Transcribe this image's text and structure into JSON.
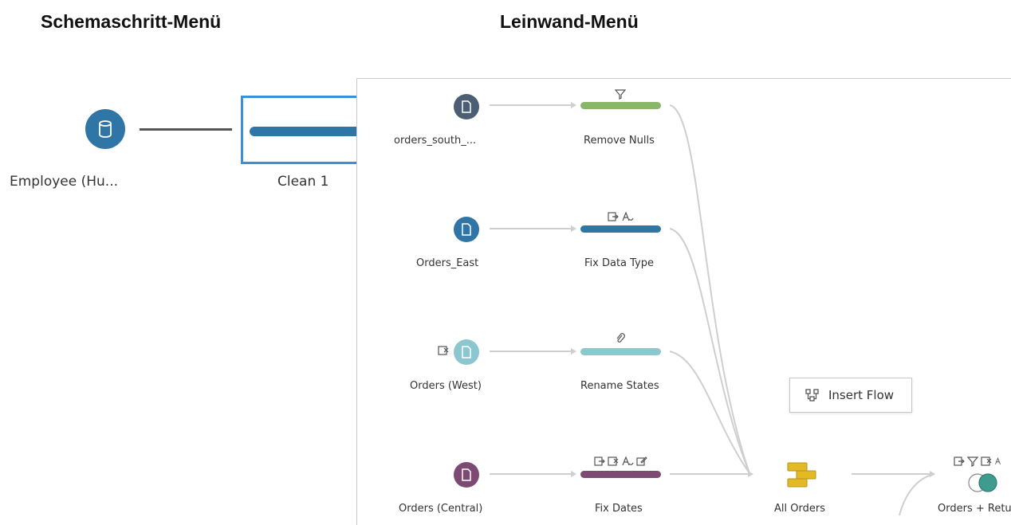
{
  "headings": {
    "step_menu": "Schemaschritt-Menü",
    "canvas_menu": "Leinwand-Menü"
  },
  "left_flow": {
    "input_node": {
      "label": "Employee (Hu...",
      "icon": "database-icon",
      "color": "#2f76a6"
    },
    "clean_step": {
      "label": "Clean 1",
      "bar_color": "#2f76a6",
      "selected_border": "#3d8fd6"
    }
  },
  "canvas": {
    "inputs": [
      {
        "label": "orders_south_...",
        "icon": "file-icon",
        "color": "#4b5e74"
      },
      {
        "label": "Orders_East",
        "icon": "file-icon",
        "color": "#2f76a6"
      },
      {
        "label": "Orders (West)",
        "icon": "file-icon",
        "color": "#8cc7cf",
        "change_icon": "removed-field-icon"
      },
      {
        "label": "Orders (Central)",
        "icon": "file-icon",
        "color": "#7d4a73"
      }
    ],
    "clean_steps": [
      {
        "label": "Remove Nulls",
        "color": "#8ab66a",
        "annotations": [
          "filter-icon"
        ]
      },
      {
        "label": "Fix Data Type",
        "color": "#2f76a6",
        "annotations": [
          "rename-field-icon",
          "change-type-icon"
        ]
      },
      {
        "label": "Rename States",
        "color": "#8cc7cf",
        "annotations": [
          "paperclip-icon"
        ]
      },
      {
        "label": "Fix Dates",
        "color": "#7d4a73",
        "annotations": [
          "rename-field-icon",
          "removed-field-icon",
          "change-type-icon",
          "edit-value-icon"
        ]
      }
    ],
    "union": {
      "label": "All Orders",
      "icon": "union-icon",
      "color": "#e3b926"
    },
    "join": {
      "label": "Orders + Retur",
      "icon": "join-icon",
      "colors": [
        "#ffffff",
        "#3f9b8e"
      ],
      "annotations": [
        "rename-field-icon",
        "filter-icon",
        "removed-field-icon",
        "change-type-icon"
      ]
    },
    "context_menu": {
      "label": "Insert Flow",
      "icon": "insert-flow-icon"
    }
  }
}
